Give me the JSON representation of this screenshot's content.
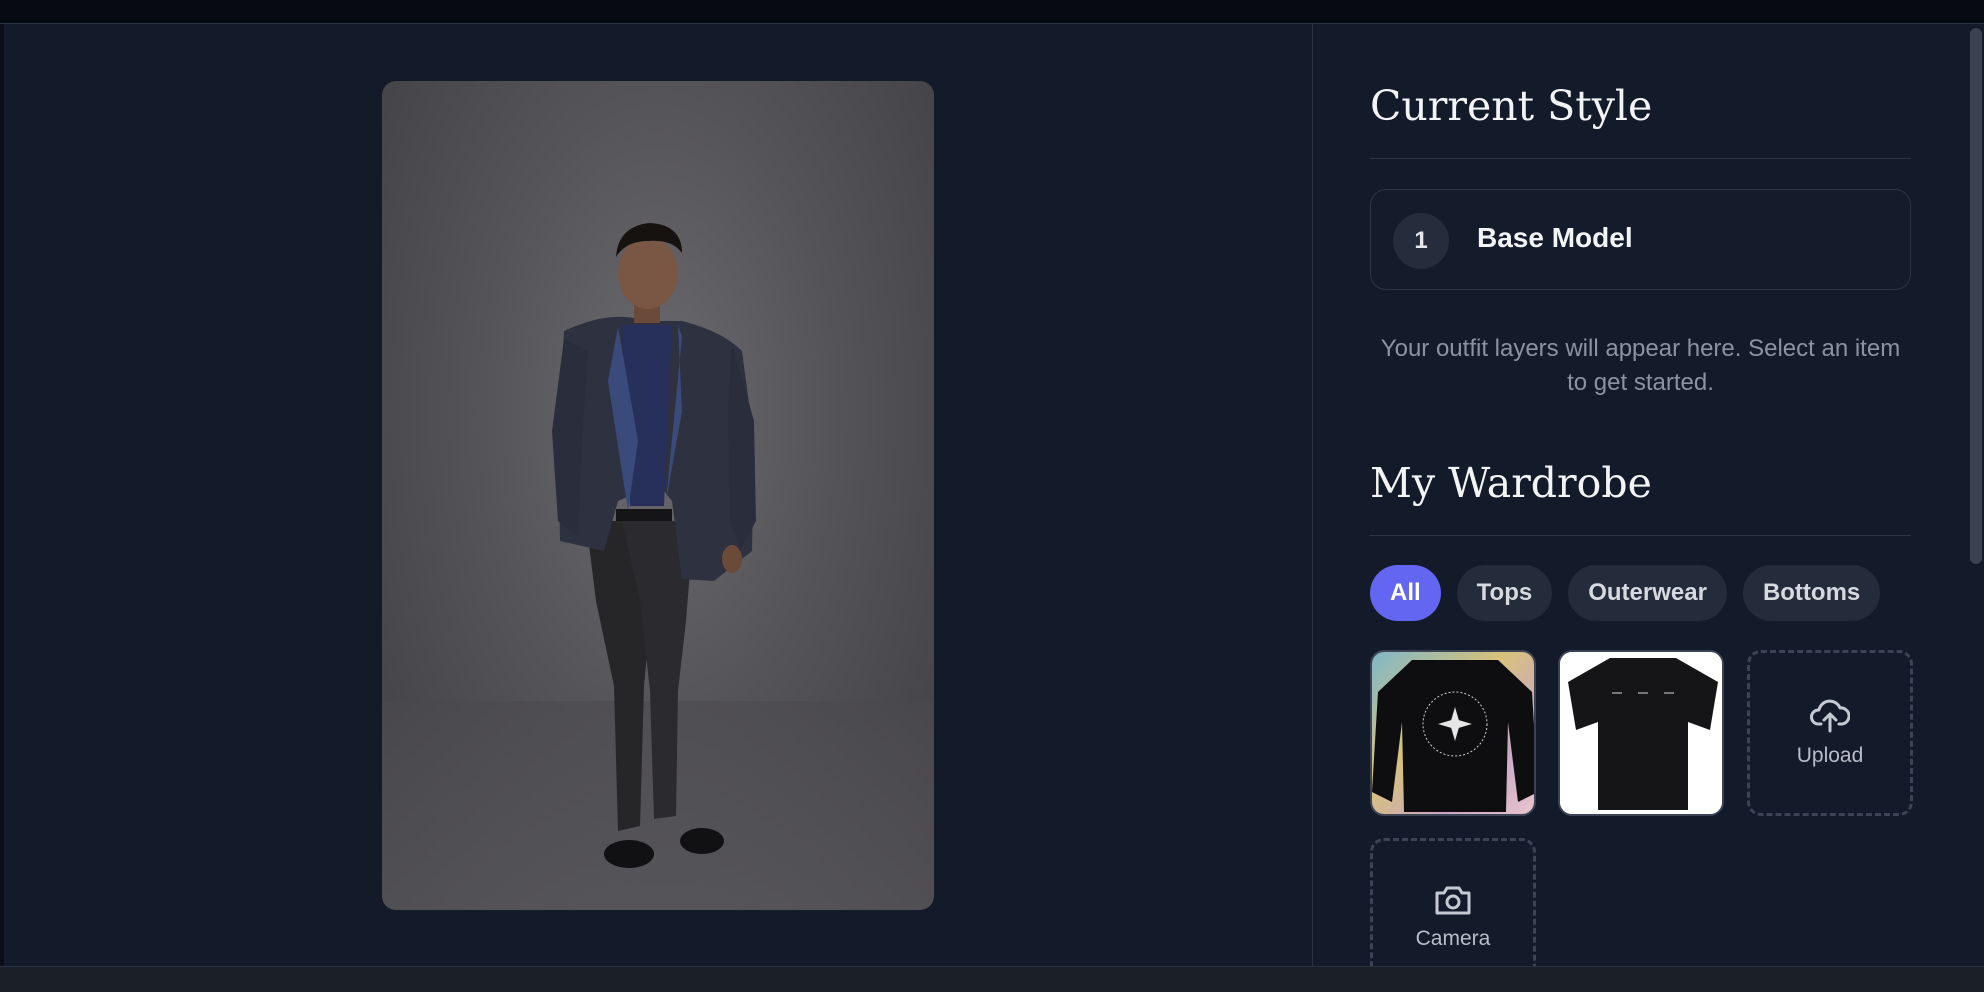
{
  "current_style": {
    "title": "Current Style",
    "layers": [
      {
        "number": "1",
        "name": "Base Model"
      }
    ],
    "empty_message": "Your outfit layers will appear here. Select an item to get started."
  },
  "wardrobe": {
    "title": "My Wardrobe",
    "filters": [
      {
        "label": "All",
        "active": true
      },
      {
        "label": "Tops",
        "active": false
      },
      {
        "label": "Outerwear",
        "active": false
      },
      {
        "label": "Bottoms",
        "active": false
      }
    ],
    "upload_label": "Upload",
    "camera_label": "Camera"
  },
  "colors": {
    "accent": "#6366f1",
    "background": "#131a2a"
  }
}
